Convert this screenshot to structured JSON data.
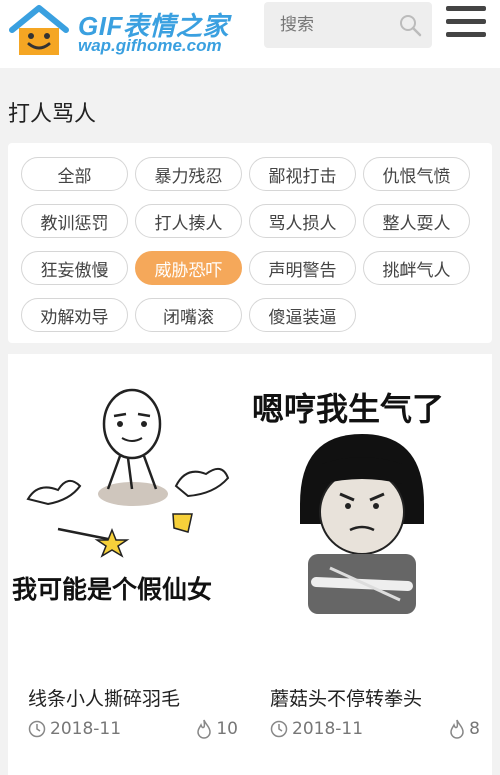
{
  "header": {
    "logo_text": "GIF表情之家",
    "logo_url": "wap.gifhome.com",
    "search_placeholder": "搜索"
  },
  "page": {
    "title": "打人骂人"
  },
  "tags": [
    {
      "label": "全部",
      "active": false
    },
    {
      "label": "暴力残忍",
      "active": false
    },
    {
      "label": "鄙视打击",
      "active": false
    },
    {
      "label": "仇恨气愤",
      "active": false
    },
    {
      "label": "教训惩罚",
      "active": false
    },
    {
      "label": "打人揍人",
      "active": false
    },
    {
      "label": "骂人损人",
      "active": false
    },
    {
      "label": "整人耍人",
      "active": false
    },
    {
      "label": "狂妄傲慢",
      "active": false
    },
    {
      "label": "威胁恐吓",
      "active": true
    },
    {
      "label": "声明警告",
      "active": false
    },
    {
      "label": "挑衅气人",
      "active": false
    },
    {
      "label": "劝解劝导",
      "active": false
    },
    {
      "label": "闭嘴滚",
      "active": false
    },
    {
      "label": "傻逼装逼",
      "active": false
    }
  ],
  "cards": [
    {
      "title": "线条小人撕碎羽毛",
      "image_caption": "我可能是个假仙女",
      "date": "2018-11",
      "views": "10"
    },
    {
      "title": "蘑菇头不停转拳头",
      "image_caption": "嗯哼我生气了",
      "date": "2018-11",
      "views": "8"
    }
  ],
  "colors": {
    "brand": "#3aa0e0",
    "accent": "#f5a85a"
  }
}
